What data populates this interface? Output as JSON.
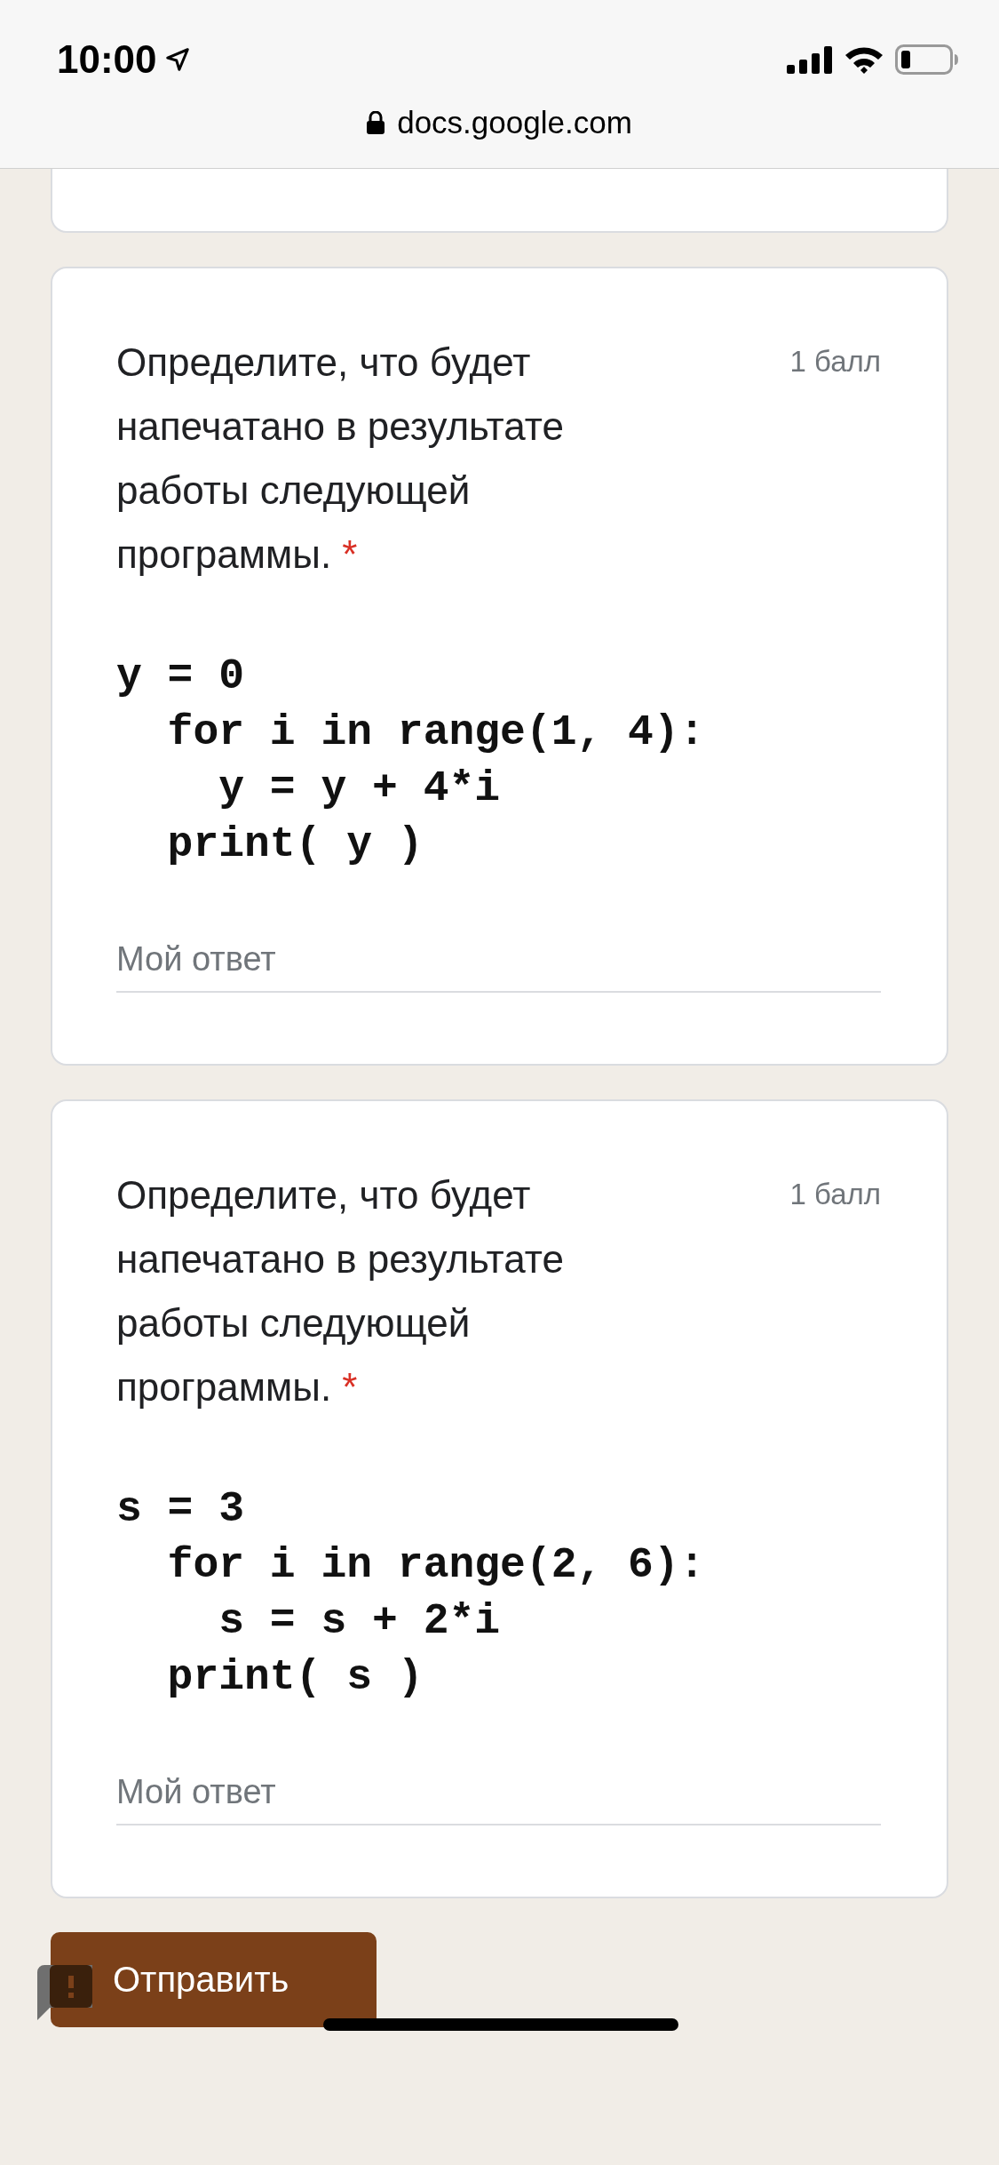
{
  "status_bar": {
    "time": "10:00"
  },
  "browser": {
    "url": "docs.google.com"
  },
  "questions": [
    {
      "text": "Определите, что будет напечатано в результате работы следующей программы.",
      "required_mark": "*",
      "points": "1 балл",
      "code": [
        "y = 0",
        "  for i in range(1, 4):",
        "    y = y + 4*i",
        "  print( y )"
      ],
      "answer_placeholder": "Мой ответ"
    },
    {
      "text": "Определите, что будет напечатано в результате работы следующей программы.",
      "required_mark": "*",
      "points": "1 балл",
      "code": [
        "s = 3",
        "  for i in range(2, 6):",
        "    s = s + 2*i",
        "  print( s )"
      ],
      "answer_placeholder": "Мой ответ"
    }
  ],
  "submit_button": {
    "label": "Отправить"
  }
}
